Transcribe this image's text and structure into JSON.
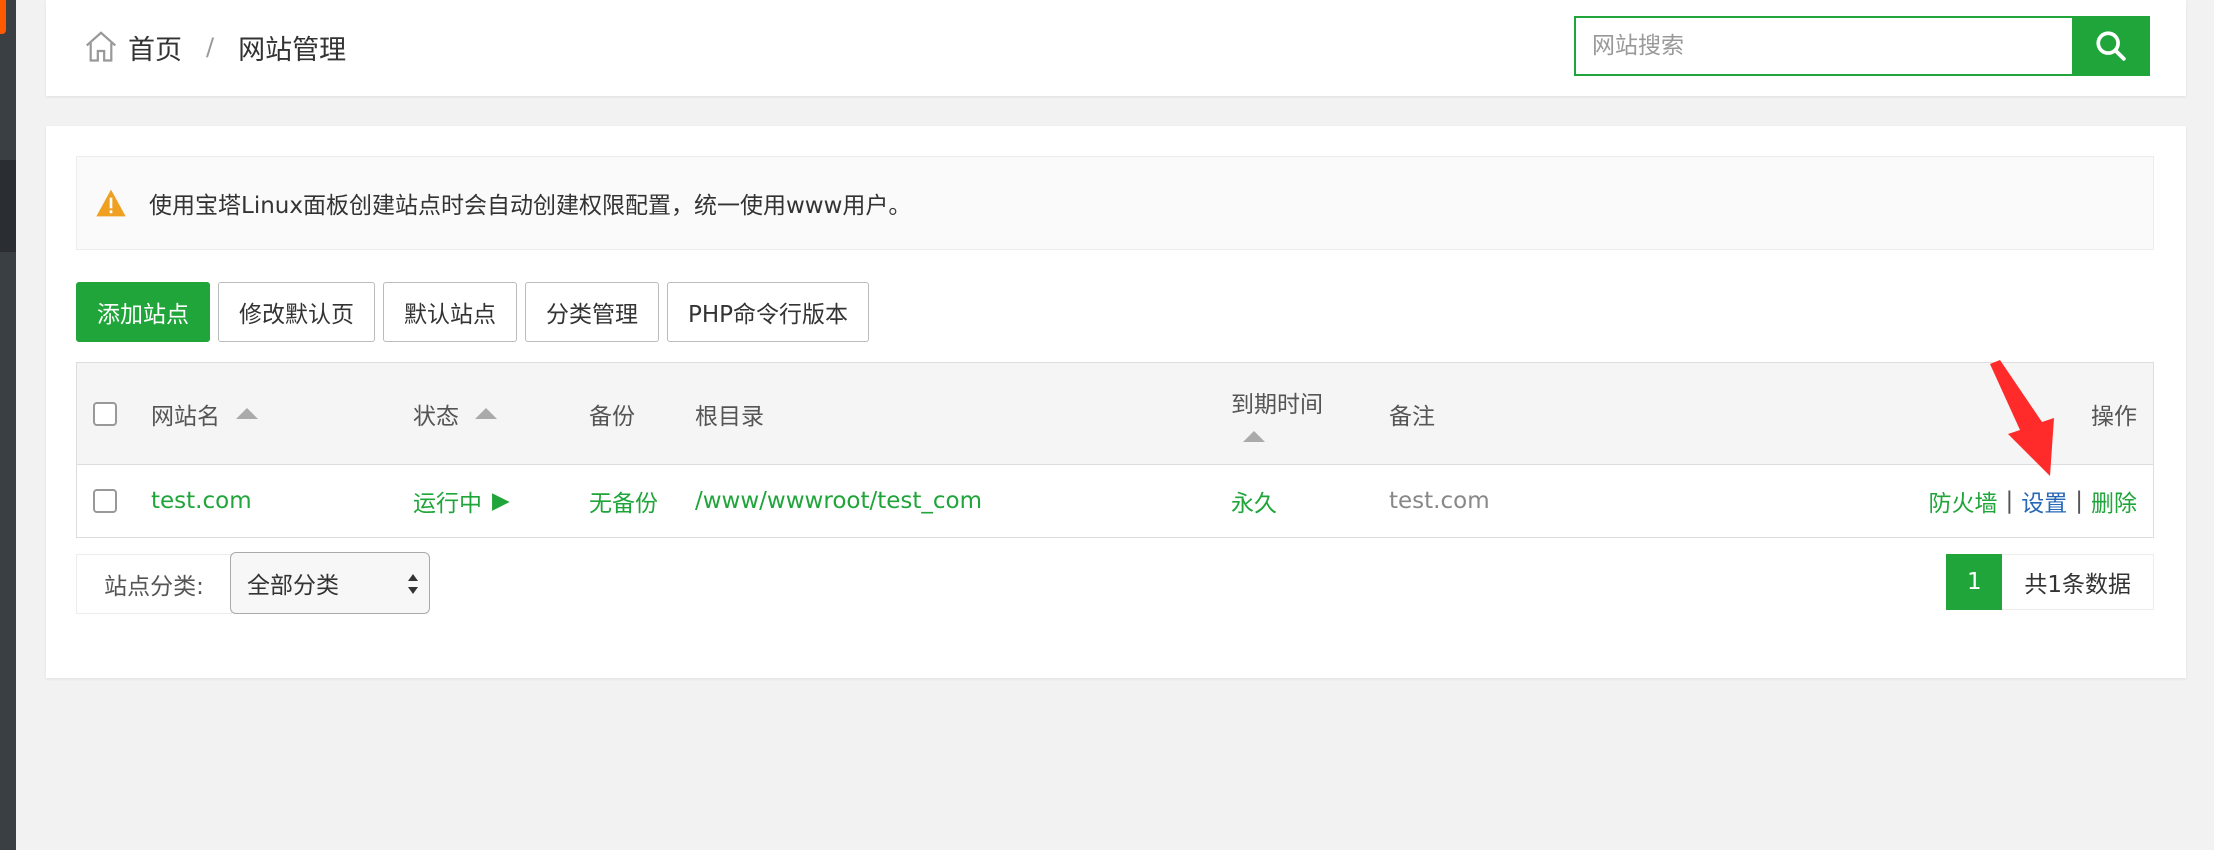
{
  "breadcrumb": {
    "home": "首页",
    "separator": "/",
    "current": "网站管理"
  },
  "search": {
    "placeholder": "网站搜索",
    "icon": "search-icon"
  },
  "notice": {
    "icon": "warning-icon",
    "text": "使用宝塔Linux面板创建站点时会自动创建权限配置，统一使用www用户。"
  },
  "toolbar": {
    "add_site": "添加站点",
    "edit_default_page": "修改默认页",
    "default_site": "默认站点",
    "category_manage": "分类管理",
    "php_cli_version": "PHP命令行版本"
  },
  "table": {
    "headers": {
      "site_name": "网站名",
      "status": "状态",
      "backup": "备份",
      "root_dir": "根目录",
      "expire_time": "到期时间",
      "remark": "备注",
      "actions": "操作"
    },
    "rows": [
      {
        "site_name": "test.com",
        "status": "运行中",
        "status_icon": "▶",
        "backup": "无备份",
        "root_dir": "/www/wwwroot/test_com",
        "expire_time": "永久",
        "remark": "test.com",
        "actions": {
          "firewall": "防火墙",
          "settings": "设置",
          "delete": "删除",
          "separator": "|"
        }
      }
    ]
  },
  "footer": {
    "category_label": "站点分类:",
    "category_selected": "全部分类",
    "page_current": "1",
    "total_text": "共1条数据"
  },
  "colors": {
    "accent": "#20a53a",
    "link_blue": "#2468b7",
    "warning": "#f0a020",
    "annotation_red": "#ff2a2a"
  }
}
